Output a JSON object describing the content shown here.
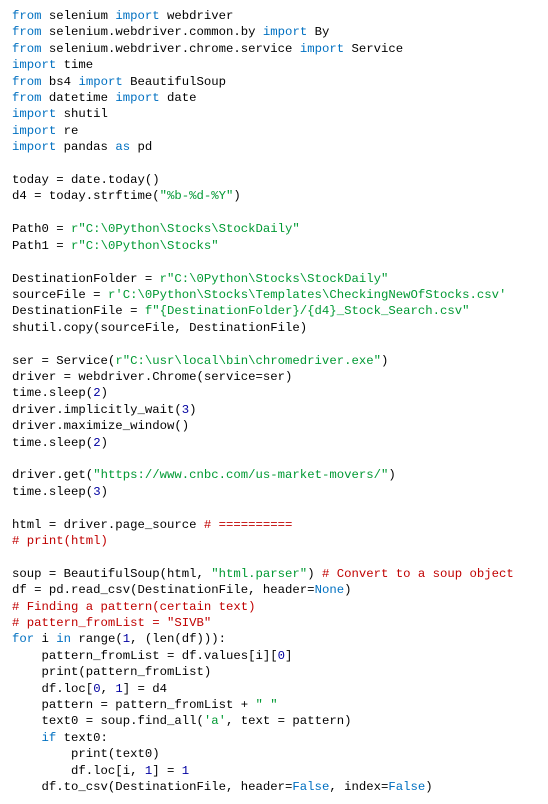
{
  "code": {
    "l1": {
      "k1": "from",
      "t1": " selenium ",
      "k2": "import",
      "t2": " webdriver"
    },
    "l2": {
      "k1": "from",
      "t1": " selenium.webdriver.common.by ",
      "k2": "import",
      "t2": " By"
    },
    "l3": {
      "k1": "from",
      "t1": " selenium.webdriver.chrome.service ",
      "k2": "import",
      "t2": " Service"
    },
    "l4": {
      "k1": "import",
      "t1": " time"
    },
    "l5": {
      "k1": "from",
      "t1": " bs4 ",
      "k2": "import",
      "t2": " BeautifulSoup"
    },
    "l6": {
      "k1": "from",
      "t1": " datetime ",
      "k2": "import",
      "t2": " date"
    },
    "l7": {
      "k1": "import",
      "t1": " shutil"
    },
    "l8": {
      "k1": "import",
      "t1": " re"
    },
    "l9": {
      "k1": "import",
      "t1": " pandas ",
      "k2": "as",
      "t2": " pd"
    },
    "l11": "today = date.today()",
    "l12a": "d4 = today.strftime(",
    "l12s": "\"%b-%d-%Y\"",
    "l12b": ")",
    "l14a": "Path0 = ",
    "l14s": "r\"C:\\0Python\\Stocks\\StockDaily\"",
    "l15a": "Path1 = ",
    "l15s": "r\"C:\\0Python\\Stocks\"",
    "l17a": "DestinationFolder = ",
    "l17s": "r\"C:\\0Python\\Stocks\\StockDaily\"",
    "l18a": "sourceFile = ",
    "l18s": "r'C:\\0Python\\Stocks\\Templates\\CheckingNewOfStocks.csv'",
    "l19a": "DestinationFile = ",
    "l19s": "f\"{DestinationFolder}/{d4}_Stock_Search.csv\"",
    "l20": "shutil.copy(sourceFile, DestinationFile)",
    "l22a": "ser = Service(",
    "l22s": "r\"C:\\usr\\local\\bin\\chromedriver.exe\"",
    "l22b": ")",
    "l23": "driver = webdriver.Chrome(service=ser)",
    "l24a": "time.sleep(",
    "l24n": "2",
    "l24b": ")",
    "l25a": "driver.implicitly_wait(",
    "l25n": "3",
    "l25b": ")",
    "l26": "driver.maximize_window()",
    "l27a": "time.sleep(",
    "l27n": "2",
    "l27b": ")",
    "l29a": "driver.get(",
    "l29s": "\"https://www.cnbc.com/us-market-movers/\"",
    "l29b": ")",
    "l30a": "time.sleep(",
    "l30n": "3",
    "l30b": ")",
    "l32a": "html = driver.page_source ",
    "l32c": "# ==========",
    "l33": "# print(html)",
    "l35a": "soup = BeautifulSoup(html, ",
    "l35s": "\"html.parser\"",
    "l35b": ") ",
    "l35c": "# Convert to a soup object",
    "l36a": "df = pd.read_csv(DestinationFile, header=",
    "l36n": "None",
    "l36b": ")",
    "l37": "# Finding a pattern(certain text)",
    "l38": "# pattern_fromList = \"SIVB\"",
    "l39k1": "for",
    "l39a": " i ",
    "l39k2": "in",
    "l39b": " range(",
    "l39n1": "1",
    "l39c": ", (len(df))):",
    "l40a": "    pattern_fromList = df.values[i][",
    "l40n": "0",
    "l40b": "]",
    "l41": "    print(pattern_fromList)",
    "l42a": "    df.loc[",
    "l42n1": "0",
    "l42b": ", ",
    "l42n2": "1",
    "l42c": "] = d4",
    "l43a": "    pattern = pattern_fromList + ",
    "l43s": "\" \"",
    "l44a": "    text0 = soup.find_all(",
    "l44s": "'a'",
    "l44b": ", text = pattern)",
    "l45k": "    if",
    "l45a": " text0:",
    "l46": "        print(text0)",
    "l47a": "        df.loc[i, ",
    "l47n": "1",
    "l47b": "] = ",
    "l47n2": "1",
    "l48a": "    df.to_csv(DestinationFile, header=",
    "l48n1": "False",
    "l48b": ", index=",
    "l48n2": "False",
    "l48c": ")"
  }
}
